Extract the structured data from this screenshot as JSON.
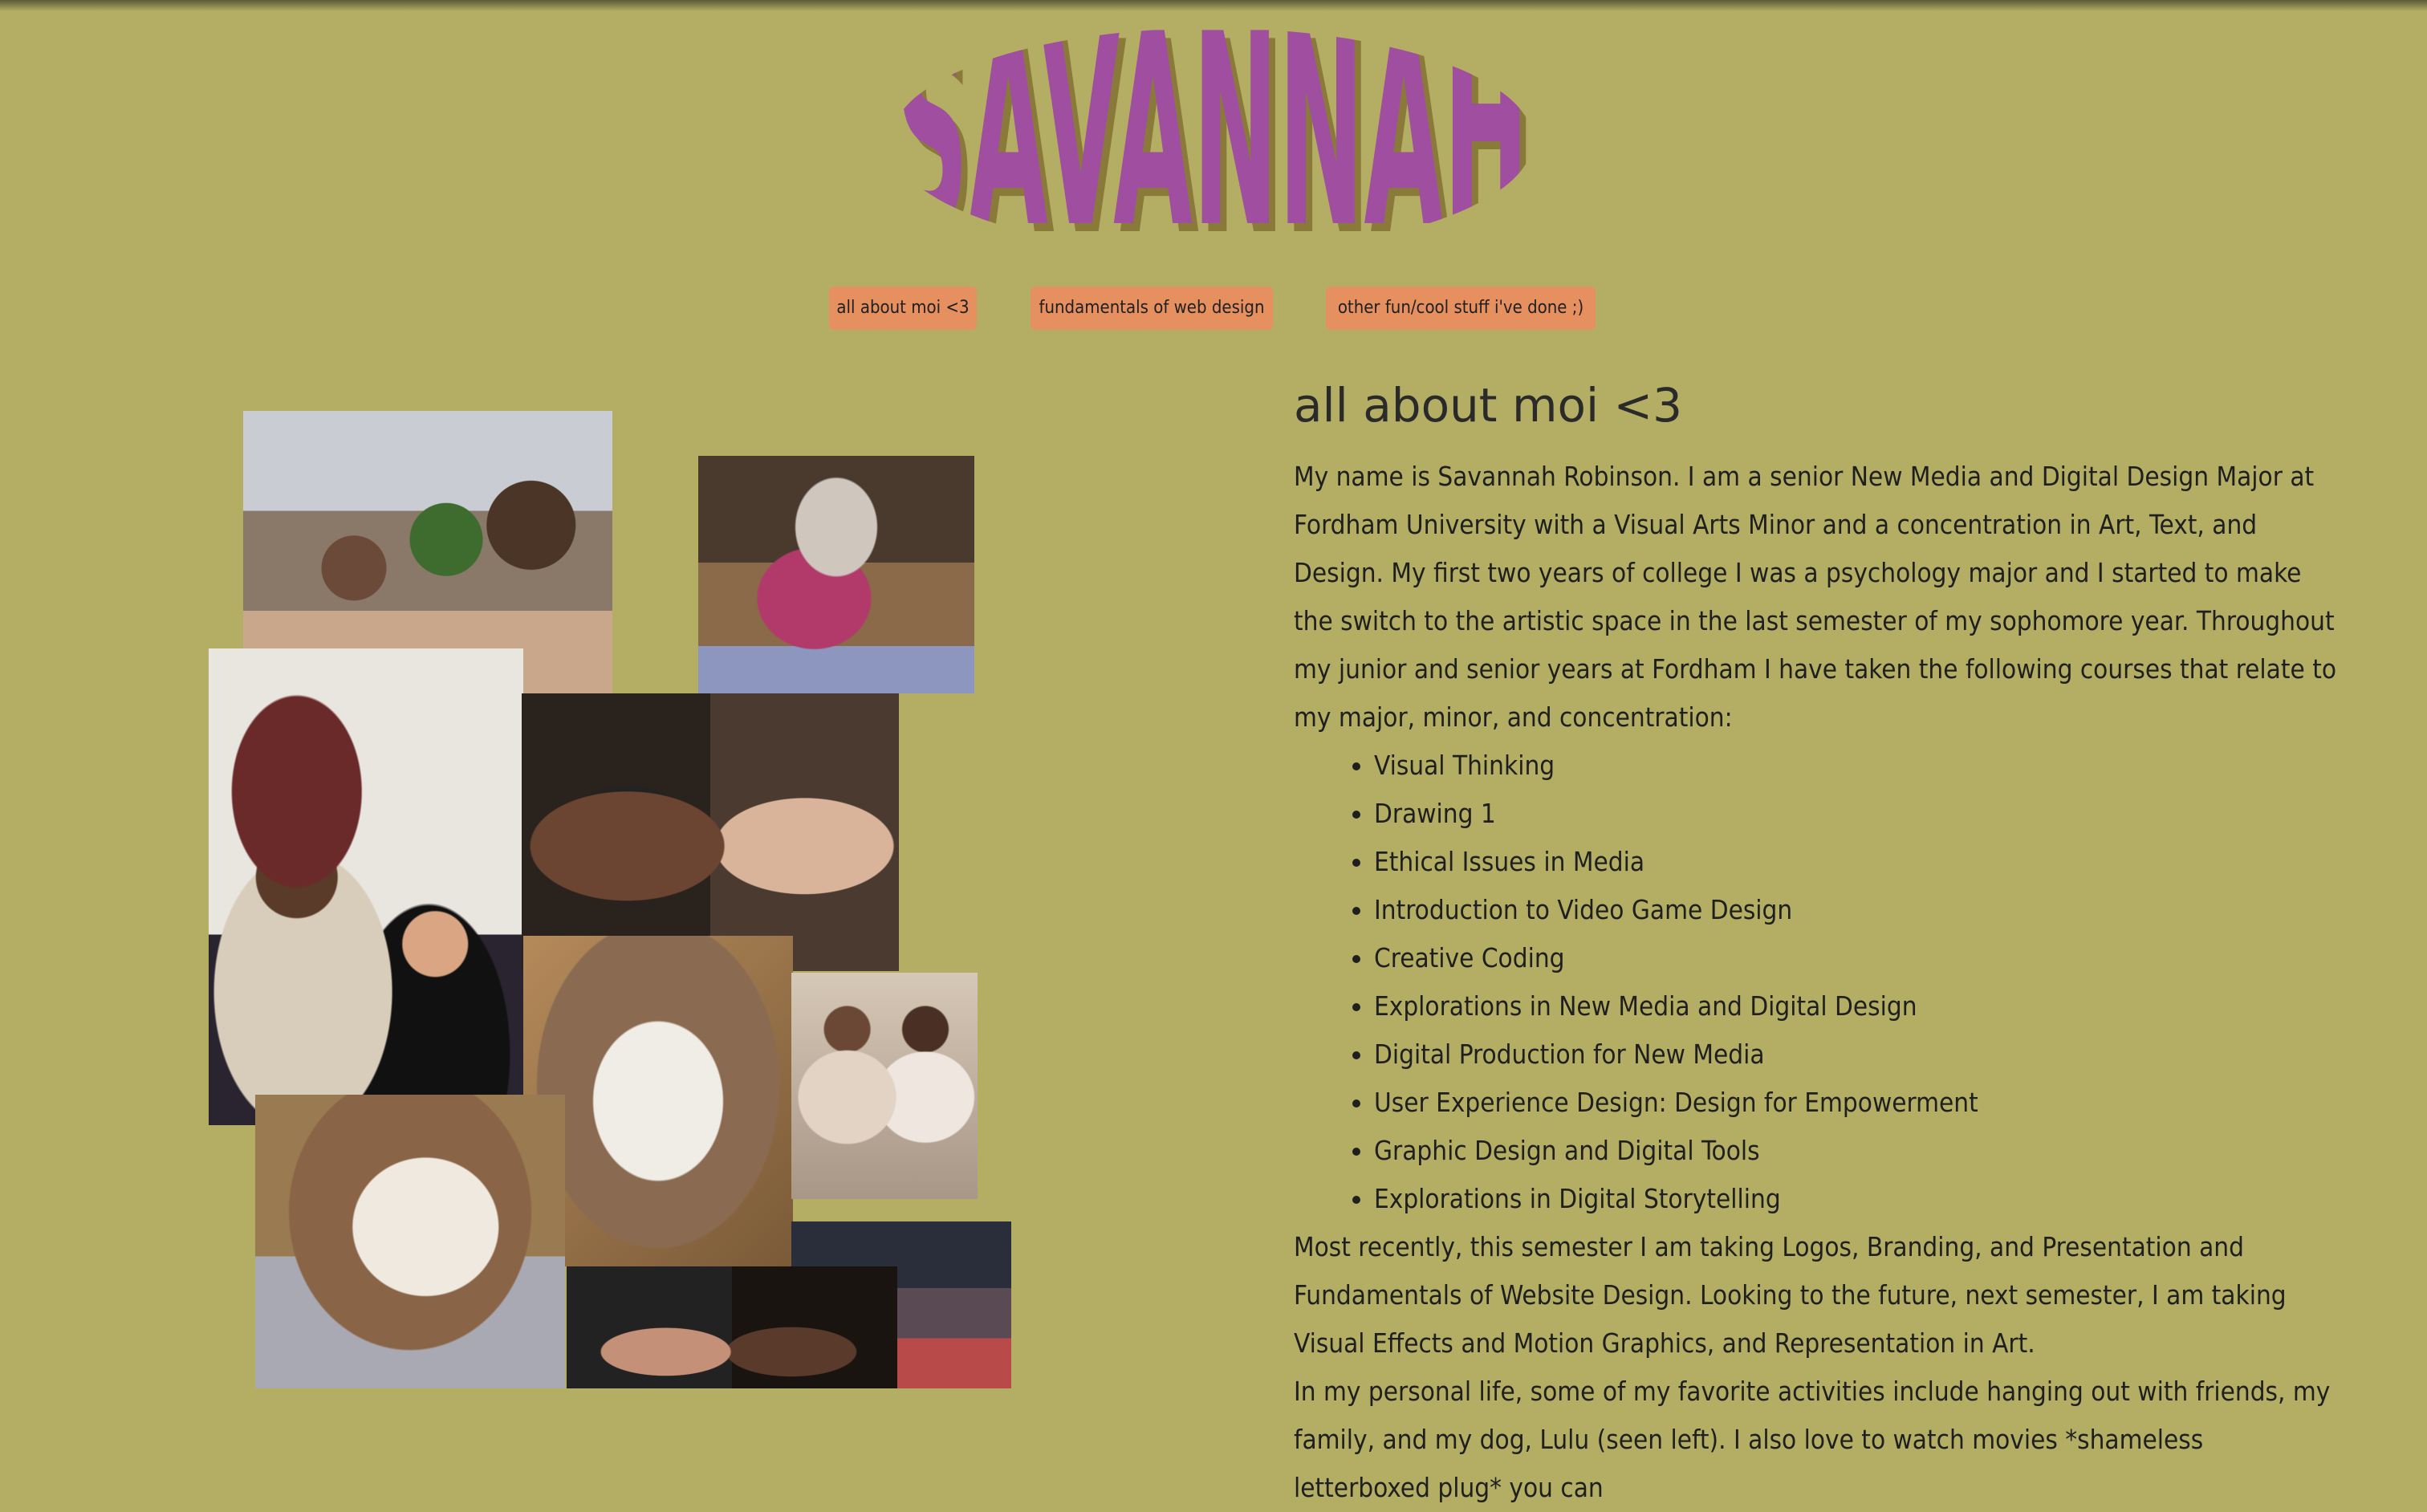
{
  "logo": {
    "text": "SAVANNAH",
    "fill": "#a04ea0",
    "shadow": "#8a7a3a"
  },
  "nav": {
    "items": [
      {
        "label": "all about moi <3"
      },
      {
        "label": "fundamentals of web design"
      },
      {
        "label": "other fun/cool stuff i've done ;)"
      }
    ],
    "color": "#e69060"
  },
  "photos": {
    "items": [
      {
        "alt": "family on couch"
      },
      {
        "alt": "dog in pink sweater"
      },
      {
        "alt": "family by christmas tree"
      },
      {
        "alt": "two friends in sunglasses"
      },
      {
        "alt": "dog face close-up"
      },
      {
        "alt": "two friends smiling"
      },
      {
        "alt": "dog sleeping on pillow"
      },
      {
        "alt": "night street scene"
      },
      {
        "alt": "two friends selfie"
      }
    ]
  },
  "main": {
    "heading": "all about moi <3",
    "intro": "My name is Savannah Robinson. I am a senior New Media and Digital Design Major at Fordham University with a Visual Arts Minor and a concentration in Art, Text, and Design. My first two years of college I was a psychology major and I started to make the switch to the artistic space in the last semester of my sophomore year. Throughout my junior and senior years at Fordham I have taken the following courses that relate to my major, minor, and concentration:",
    "courses": [
      "Visual Thinking",
      "Drawing 1",
      "Ethical Issues in Media",
      "Introduction to Video Game Design",
      "Creative Coding",
      "Explorations in New Media and Digital Design",
      "Digital Production for New Media",
      "User Experience Design: Design for Empowerment",
      "Graphic Design and Digital Tools",
      "Explorations in Digital Storytelling"
    ],
    "recent": "Most recently, this semester I am taking Logos, Branding, and Presentation and Fundamentals of Website Design. Looking to the future, next semester, I am taking Visual Effects and Motion Graphics, and Representation in Art.",
    "personal": "In my personal life, some of my favorite activities include hanging out with friends, my family, and my dog, Lulu (seen left). I also love to watch movies *shameless letterboxed plug* you can"
  },
  "colors": {
    "background": "#b3ae64",
    "text": "#1f1f1f"
  }
}
